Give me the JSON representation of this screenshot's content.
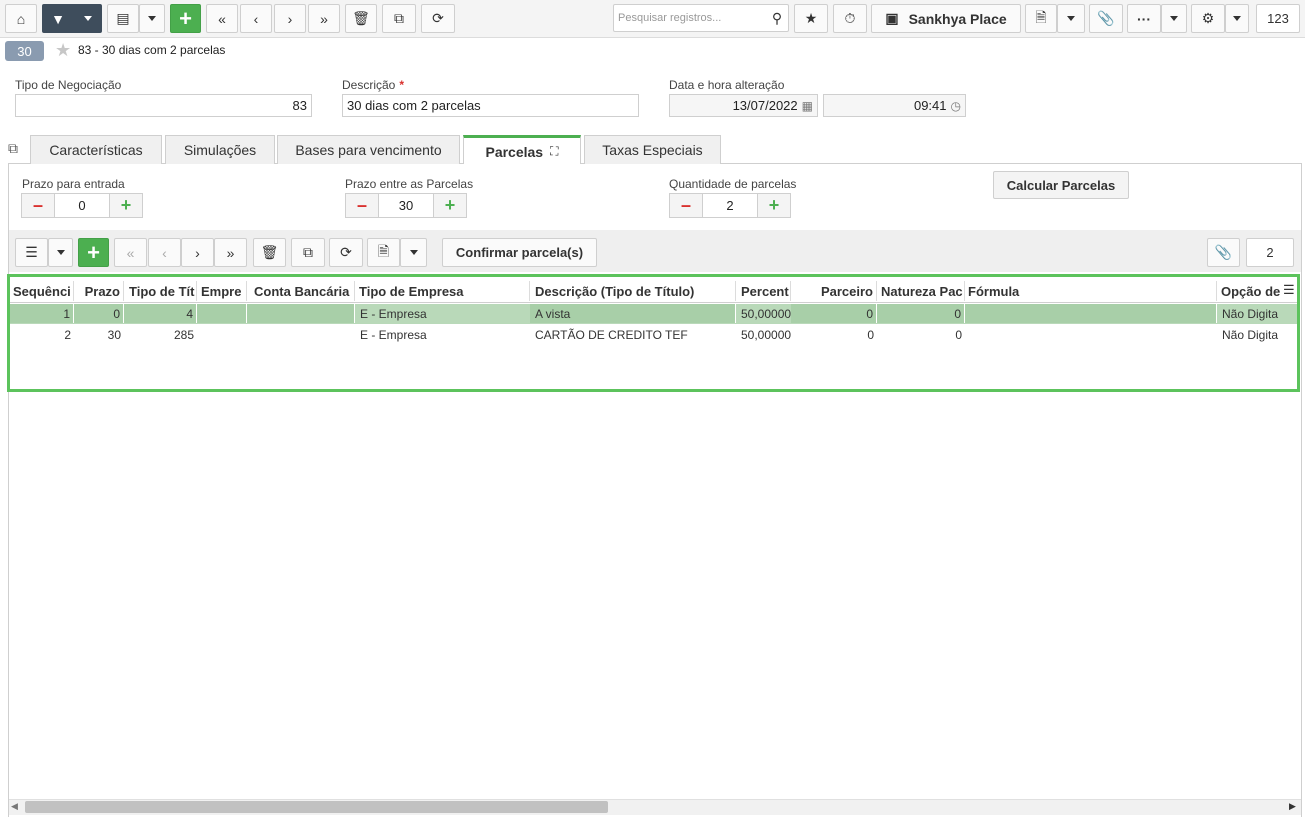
{
  "toolbar": {
    "search_placeholder": "Pesquisar registros...",
    "sankhya_place_label": "Sankhya Place",
    "counter": "123"
  },
  "breadcrumb": {
    "badge": "30",
    "title": "83 - 30 dias com 2 parcelas"
  },
  "form": {
    "tipo_label": "Tipo de Negociação",
    "tipo_value": "83",
    "descricao_label": "Descrição",
    "descricao_value": "30 dias com 2 parcelas",
    "data_label": "Data e hora alteração",
    "data_value": "13/07/2022",
    "hora_value": "09:41"
  },
  "tabs": [
    {
      "label": "Características"
    },
    {
      "label": "Simulações"
    },
    {
      "label": "Bases para vencimento"
    },
    {
      "label": "Parcelas"
    },
    {
      "label": "Taxas Especiais"
    }
  ],
  "parcelas": {
    "prazo_entrada_label": "Prazo para entrada",
    "prazo_entrada_value": "0",
    "prazo_entre_label": "Prazo entre as Parcelas",
    "prazo_entre_value": "30",
    "quantidade_label": "Quantidade de parcelas",
    "quantidade_value": "2",
    "calcular_label": "Calcular Parcelas"
  },
  "grid_toolbar": {
    "confirmar_label": "Confirmar parcela(s)",
    "counter": "2"
  },
  "grid": {
    "headers": [
      "Sequênci",
      "Prazo",
      "Tipo de Tít",
      "Empre",
      "Conta Bancária",
      "Tipo de Empresa",
      "Descrição (Tipo de Título)",
      "Percent",
      "Parceiro",
      "Natureza Pac",
      "Fórmula",
      "Opção de"
    ],
    "rows": [
      [
        "1",
        "0",
        "4",
        "",
        "",
        "E - Empresa",
        "A vista",
        "50,00000",
        "0",
        "0",
        "",
        "Não Digita"
      ],
      [
        "2",
        "30",
        "285",
        "",
        "",
        "E - Empresa",
        "CARTÃO DE CREDITO TEF",
        "50,00000",
        "0",
        "0",
        "",
        "Não Digita"
      ]
    ]
  },
  "colors": {
    "accent_green": "#4caf50",
    "selection_row": "#b9d9b9",
    "badge": "#8a9bb0"
  }
}
